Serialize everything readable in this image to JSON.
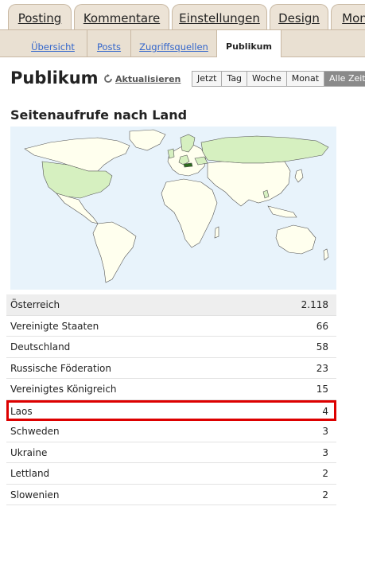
{
  "tabs": [
    "Posting",
    "Kommentare",
    "Einstellungen",
    "Design",
    "Mon"
  ],
  "subnav": {
    "items": [
      "Übersicht",
      "Posts",
      "Zugriffsquellen"
    ],
    "active": "Publikum"
  },
  "header": {
    "title": "Publikum",
    "refresh_label": "Aktualisieren"
  },
  "time_range": {
    "options": [
      "Jetzt",
      "Tag",
      "Woche",
      "Monat",
      "Alle Zeiten"
    ],
    "selected": "Alle Zeiten"
  },
  "section_title": "Seitenaufrufe nach Land",
  "map": {
    "ocean_color": "#e8f3fb",
    "land_color": "#ffffee",
    "highlight_color": "#d6f0c0",
    "top_color": "#2d6a1e"
  },
  "countries": [
    {
      "name": "Österreich",
      "views": "2.118"
    },
    {
      "name": "Vereinigte Staaten",
      "views": "66"
    },
    {
      "name": "Deutschland",
      "views": "58"
    },
    {
      "name": "Russische Föderation",
      "views": "23"
    },
    {
      "name": "Vereinigtes Königreich",
      "views": "15"
    },
    {
      "name": "Laos",
      "views": "4"
    },
    {
      "name": "Schweden",
      "views": "3"
    },
    {
      "name": "Ukraine",
      "views": "3"
    },
    {
      "name": "Lettland",
      "views": "2"
    },
    {
      "name": "Slowenien",
      "views": "2"
    }
  ],
  "highlight_color": "#dd0000"
}
